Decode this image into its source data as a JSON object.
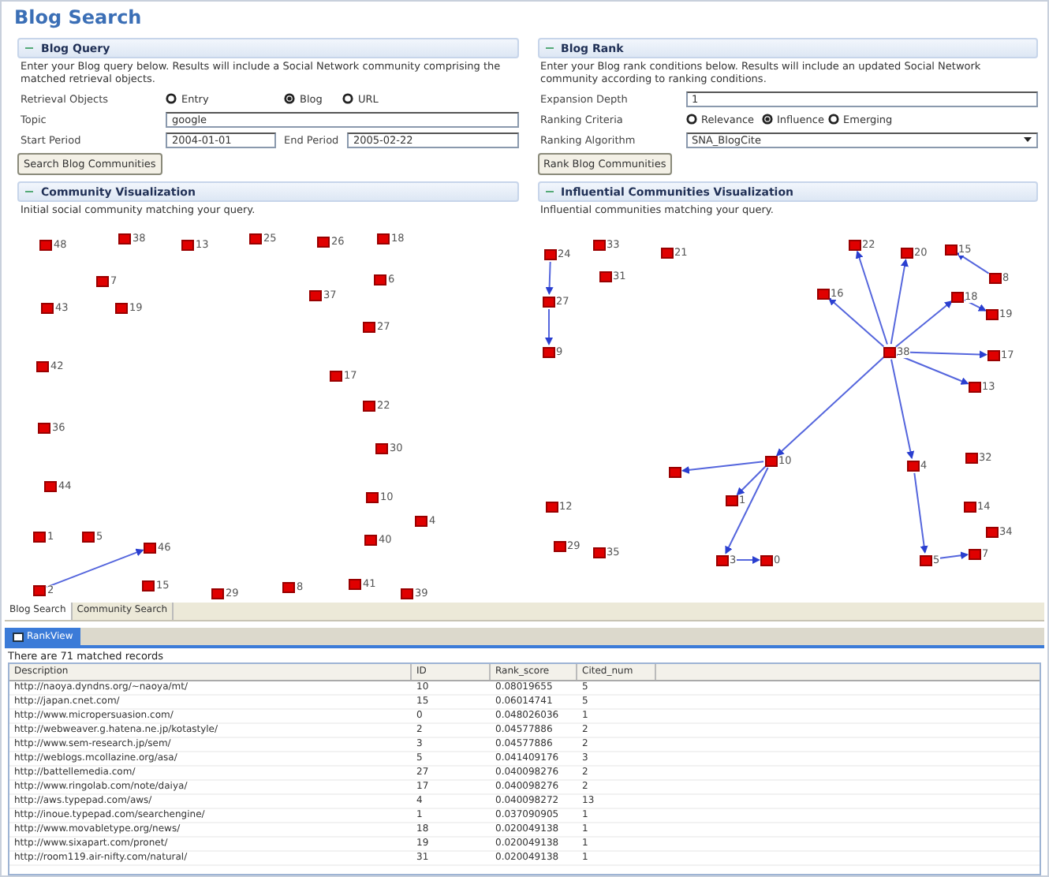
{
  "title": "Blog Search",
  "blog_query": {
    "heading": "Blog Query",
    "description": "Enter your Blog query below. Results will include a Social Network community comprising the matched retrieval objects.",
    "retrieval_label": "Retrieval Objects",
    "retrieval_options": [
      {
        "label": "Entry",
        "selected": false
      },
      {
        "label": "Blog",
        "selected": true
      },
      {
        "label": "URL",
        "selected": false
      }
    ],
    "topic_label": "Topic",
    "topic_value": "google",
    "start_label": "Start Period",
    "start_value": "2004-01-01",
    "end_label": "End Period",
    "end_value": "2005-02-22",
    "button": "Search Blog Communities"
  },
  "community_visualization": {
    "heading": "Community Visualization",
    "description": "Initial social community matching your query.",
    "nodes": [
      {
        "label": "48"
      },
      {
        "label": "38"
      },
      {
        "label": "13"
      },
      {
        "label": "25"
      },
      {
        "label": "26"
      },
      {
        "label": "18"
      },
      {
        "label": "7"
      },
      {
        "label": "6"
      },
      {
        "label": "37"
      },
      {
        "label": "43"
      },
      {
        "label": "19"
      },
      {
        "label": "27"
      },
      {
        "label": "42"
      },
      {
        "label": "17"
      },
      {
        "label": "22"
      },
      {
        "label": "36"
      },
      {
        "label": "30"
      },
      {
        "label": "44"
      },
      {
        "label": "10"
      },
      {
        "label": "4"
      },
      {
        "label": "1"
      },
      {
        "label": "5"
      },
      {
        "label": "46"
      },
      {
        "label": "40"
      },
      {
        "label": "2"
      },
      {
        "label": "15"
      },
      {
        "label": "29"
      },
      {
        "label": "8"
      },
      {
        "label": "41"
      },
      {
        "label": "39"
      }
    ]
  },
  "blog_rank": {
    "heading": "Blog Rank",
    "description": "Enter your Blog rank conditions below. Results will include an updated Social Network community according to ranking conditions.",
    "depth_label": "Expansion Depth",
    "depth_value": "1",
    "criteria_label": "Ranking Criteria",
    "criteria_options": [
      {
        "label": "Relevance",
        "selected": false
      },
      {
        "label": "Influence",
        "selected": true
      },
      {
        "label": "Emerging",
        "selected": false
      }
    ],
    "algorithm_label": "Ranking Algorithm",
    "algorithm_value": "SNA_BlogCite",
    "button": "Rank Blog Communities"
  },
  "influential_visualization": {
    "heading": "Influential Communities Visualization",
    "description": "Influential communities matching your query.",
    "nodes": [
      {
        "label": "24"
      },
      {
        "label": "33"
      },
      {
        "label": "21"
      },
      {
        "label": "22"
      },
      {
        "label": "20"
      },
      {
        "label": "15"
      },
      {
        "label": "8"
      },
      {
        "label": "31"
      },
      {
        "label": "16"
      },
      {
        "label": "18"
      },
      {
        "label": "19"
      },
      {
        "label": "27"
      },
      {
        "label": "9"
      },
      {
        "label": "38"
      },
      {
        "label": "17"
      },
      {
        "label": "13"
      },
      {
        "label": "10"
      },
      {
        "label": "4"
      },
      {
        "label": "32"
      },
      {
        "label": "1"
      },
      {
        "label": "12"
      },
      {
        "label": "14"
      },
      {
        "label": "34"
      },
      {
        "label": "29"
      },
      {
        "label": "35"
      },
      {
        "label": "3"
      },
      {
        "label": "0"
      },
      {
        "label": "5"
      },
      {
        "label": "7"
      }
    ]
  },
  "editor_tabs": [
    {
      "label": "Blog Search",
      "selected": true
    },
    {
      "label": "Community Search",
      "selected": false
    }
  ],
  "rank_view": {
    "tab": "RankView",
    "summary": "There are 71 matched records",
    "columns": [
      "Description",
      "ID",
      "Rank_score",
      "Cited_num"
    ],
    "rows": [
      [
        "http://naoya.dyndns.org/~naoya/mt/",
        "10",
        "0.08019655",
        "5"
      ],
      [
        "http://japan.cnet.com/",
        "15",
        "0.06014741",
        "5"
      ],
      [
        "http://www.micropersuasion.com/",
        "0",
        "0.048026036",
        "1"
      ],
      [
        "http://webweaver.g.hatena.ne.jp/kotastyle/",
        "2",
        "0.04577886",
        "2"
      ],
      [
        "http://www.sem-research.jp/sem/",
        "3",
        "0.04577886",
        "2"
      ],
      [
        "http://weblogs.mcollazine.org/asa/",
        "5",
        "0.041409176",
        "3"
      ],
      [
        "http://battellemedia.com/",
        "27",
        "0.040098276",
        "2"
      ],
      [
        "http://www.ringolab.com/note/daiya/",
        "17",
        "0.040098276",
        "2"
      ],
      [
        "http://aws.typepad.com/aws/",
        "4",
        "0.040098272",
        "13"
      ],
      [
        "http://inoue.typepad.com/searchengine/",
        "1",
        "0.037090905",
        "1"
      ],
      [
        "http://www.movabletype.org/news/",
        "18",
        "0.020049138",
        "1"
      ],
      [
        "http://www.sixapart.com/pronet/",
        "19",
        "0.020049138",
        "1"
      ],
      [
        "http://room119.air-nifty.com/natural/",
        "31",
        "0.020049138",
        "1"
      ]
    ]
  }
}
